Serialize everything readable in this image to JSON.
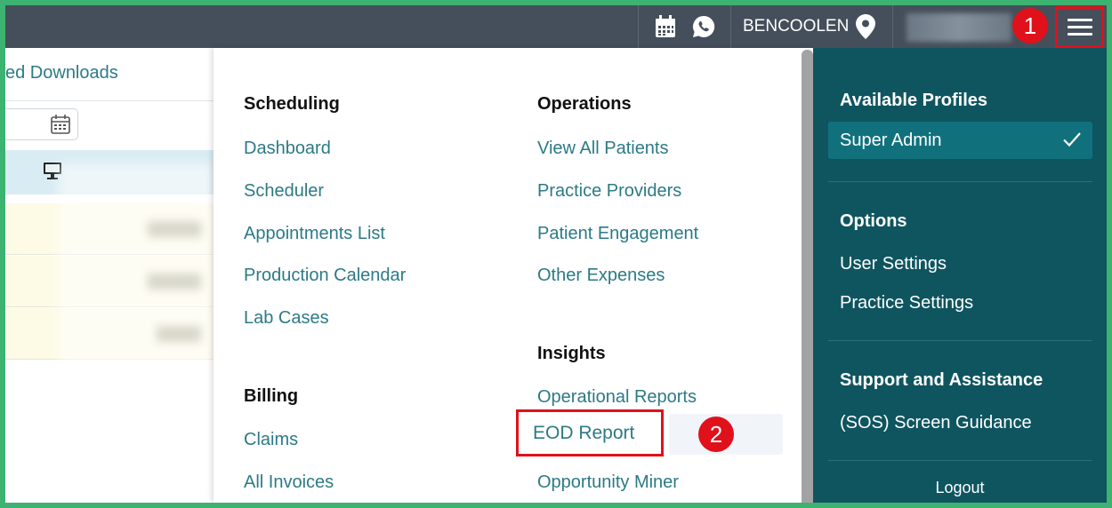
{
  "topbar": {
    "location": "BENCOOLEN",
    "icons": [
      "calendar-icon",
      "whatsapp-icon",
      "location-pin-icon",
      "menu-icon"
    ]
  },
  "background_page": {
    "downloads_link": "ed Downloads"
  },
  "menu": {
    "scheduling": {
      "title": "Scheduling",
      "items": [
        "Dashboard",
        "Scheduler",
        "Appointments List",
        "Production Calendar",
        "Lab Cases"
      ]
    },
    "billing": {
      "title": "Billing",
      "items": [
        "Claims",
        "All Invoices"
      ]
    },
    "operations": {
      "title": "Operations",
      "items": [
        "View All Patients",
        "Practice Providers",
        "Patient Engagement",
        "Other Expenses"
      ]
    },
    "insights": {
      "title": "Insights",
      "items": [
        "Operational Reports",
        "EOD Report",
        "Opportunity Miner"
      ]
    }
  },
  "right_panel": {
    "profiles_title": "Available Profiles",
    "active_profile": "Super Admin",
    "options_title": "Options",
    "options": [
      "User Settings",
      "Practice Settings"
    ],
    "support_title": "Support and Assistance",
    "support_items": [
      "(SOS) Screen Guidance"
    ],
    "logout": "Logout"
  },
  "annotations": {
    "step1": "1",
    "step2": "2",
    "highlight_color": "#e0111b"
  },
  "colors": {
    "topbar": "#454f5b",
    "link": "#2c7a86",
    "panel": "#0f5560",
    "active_profile": "#10717d",
    "border": "#3cb371"
  }
}
